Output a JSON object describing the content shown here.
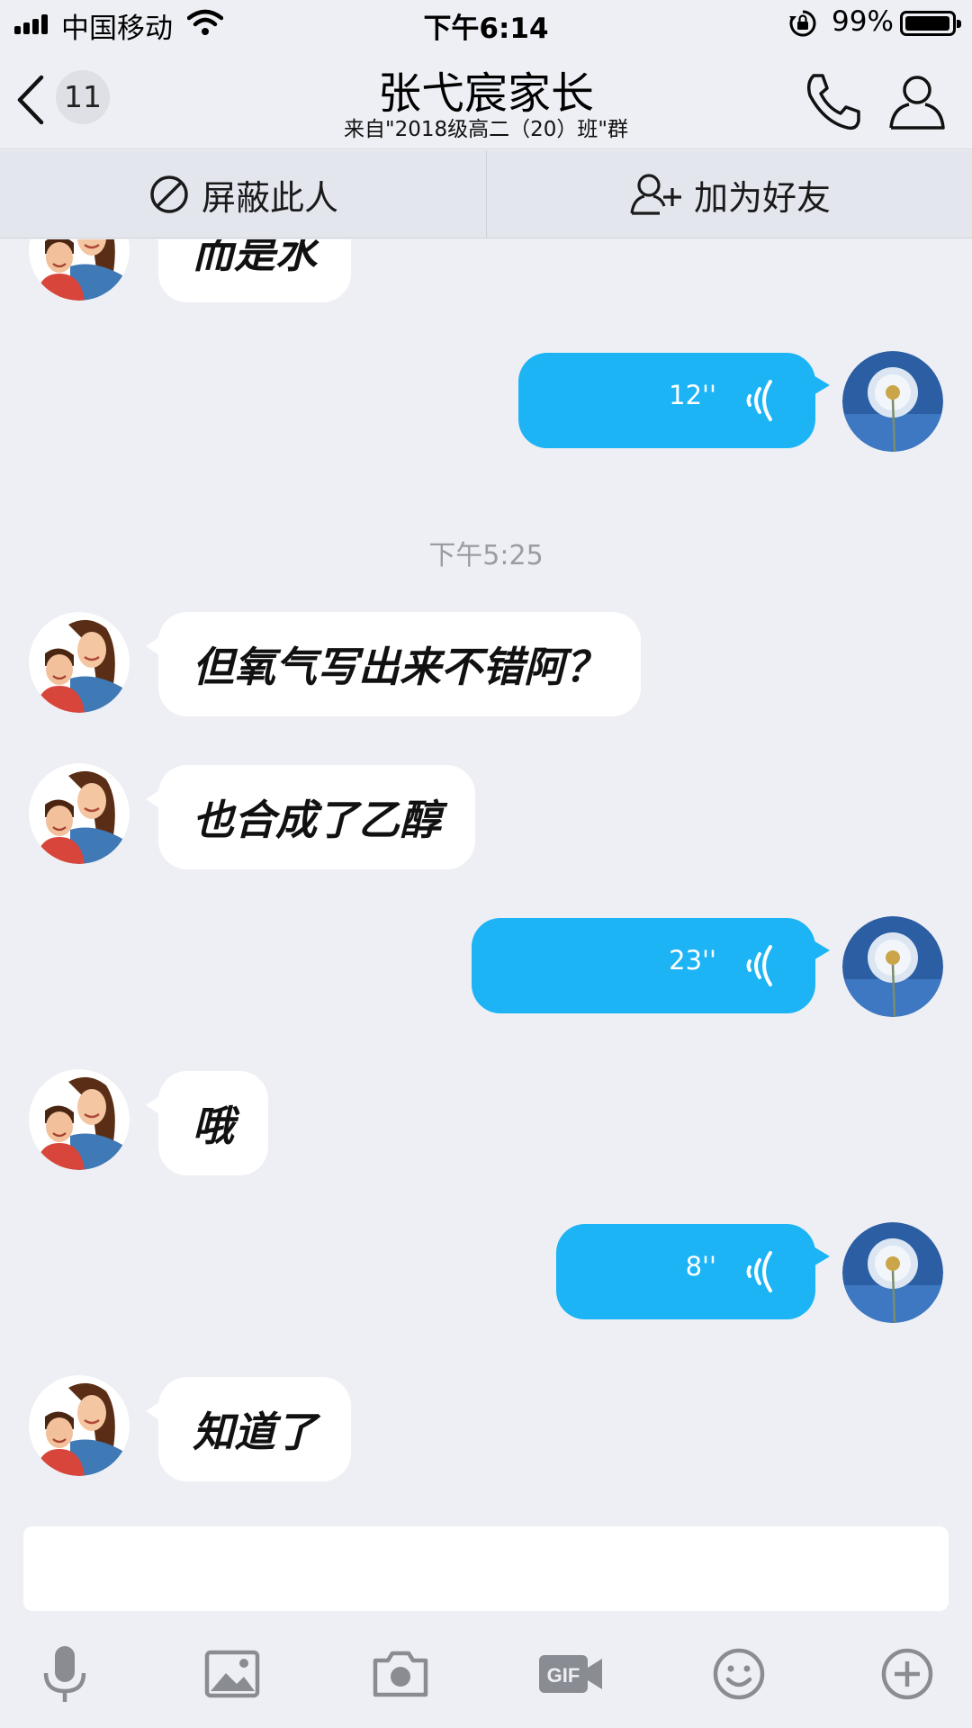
{
  "status_bar": {
    "carrier": "中国移动",
    "time": "下午6:14",
    "battery_percent": "99%",
    "icons": [
      "signal-icon",
      "wifi-icon",
      "rotation-lock-icon",
      "battery-icon"
    ]
  },
  "header": {
    "back_badge": "11",
    "title": "张弋宸家长",
    "subtitle": "来自\"2018级高二（20）班\"群",
    "icons": [
      "back-chevron-icon",
      "phone-icon",
      "profile-icon"
    ]
  },
  "action_bar": {
    "block_label": "屏蔽此人",
    "add_friend_label": "加为好友",
    "icons": [
      "block-icon",
      "add-friend-icon"
    ]
  },
  "messages": {
    "m0": {
      "text": "而是水"
    },
    "m1": {
      "duration": "12''"
    },
    "timestamp": "下午5:25",
    "m2": {
      "text": "但氧气写出来不错阿？"
    },
    "m3": {
      "text": "也合成了乙醇"
    },
    "m4": {
      "duration": "23''"
    },
    "m5": {
      "text": "哦"
    },
    "m6": {
      "duration": "8''"
    },
    "m7": {
      "text": "知道了"
    }
  },
  "input": {
    "value": "",
    "placeholder": ""
  },
  "toolbar": {
    "items": [
      "microphone-icon",
      "image-icon",
      "camera-icon",
      "gif-icon",
      "emoji-icon",
      "plus-icon"
    ],
    "gif_label": "GIF"
  },
  "colors": {
    "background": "#eeeff4",
    "action_bar": "#e4e6ee",
    "outgoing_bubble": "#1cb4f5",
    "incoming_bubble": "#ffffff",
    "timestamp_text": "#9b9ca3",
    "toolbar_icon": "#8a8c94"
  }
}
